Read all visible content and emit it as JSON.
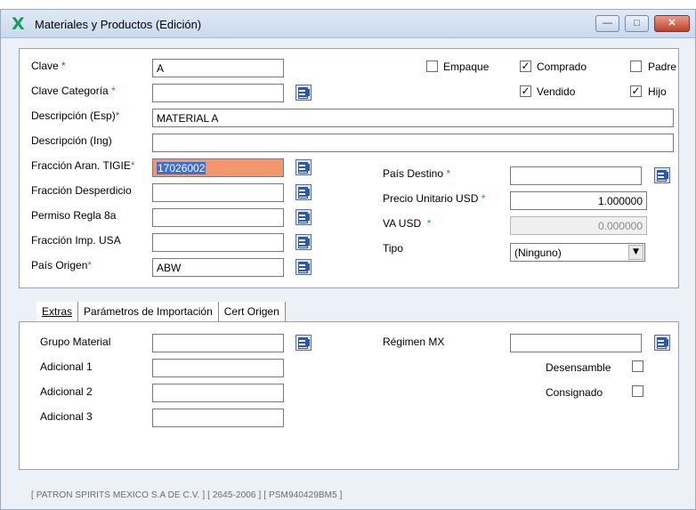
{
  "window": {
    "logo": "X",
    "title": "Materiales y Productos (Edición)",
    "minimize": "—",
    "maximize": "□",
    "close": "✕"
  },
  "form": {
    "clave": {
      "label": "Clave",
      "req": "*",
      "value": "A"
    },
    "clave_categoria": {
      "label": "Clave Categoría",
      "req": "*",
      "value": ""
    },
    "descripcion_esp": {
      "label": "Descripción (Esp)",
      "req": "*",
      "value": "MATERIAL A"
    },
    "descripcion_ing": {
      "label": "Descripción (Ing)",
      "value": ""
    },
    "fraccion_aran_tigie": {
      "label": "Fracción Aran. TIGIE",
      "req": "*",
      "value": "17026002"
    },
    "fraccion_desperdicio": {
      "label": "Fracción Desperdicio",
      "value": ""
    },
    "permiso_regla_8a": {
      "label": "Permiso Regla 8a",
      "value": ""
    },
    "fraccion_imp_usa": {
      "label": "Fracción Imp. USA",
      "value": ""
    },
    "pais_origen": {
      "label": "País Origen",
      "req": "*",
      "value": "ABW"
    },
    "pais_destino": {
      "label": "País Destino",
      "req": "*",
      "value": ""
    },
    "precio_unitario_usd": {
      "label": "Precio Unitario USD",
      "req": "*",
      "value": "1.000000"
    },
    "va_usd": {
      "label": "VA USD",
      "req": "*",
      "value": "0.000000"
    },
    "tipo": {
      "label": "Tipo",
      "value": "(Ninguno)"
    },
    "checkboxes": {
      "empaque": {
        "label": "Empaque",
        "checked": false,
        "mark": ""
      },
      "comprado": {
        "label": "Comprado",
        "checked": true,
        "mark": "✓"
      },
      "padre": {
        "label": "Padre",
        "checked": false,
        "mark": ""
      },
      "vendido": {
        "label": "Vendido",
        "checked": true,
        "mark": "✓"
      },
      "hijo": {
        "label": "Hijo",
        "checked": true,
        "mark": "✓"
      }
    }
  },
  "tabs": [
    {
      "label": "Extras",
      "active": true
    },
    {
      "label": "Parámetros de Importación",
      "active": false
    },
    {
      "label": "Cert Origen",
      "active": false
    }
  ],
  "extras": {
    "grupo_material": {
      "label": "Grupo Material",
      "value": ""
    },
    "adicional_1": {
      "label": "Adicional 1",
      "value": ""
    },
    "adicional_2": {
      "label": "Adicional 2",
      "value": ""
    },
    "adicional_3": {
      "label": "Adicional 3",
      "value": ""
    },
    "regimen_mx": {
      "label": "Régimen MX",
      "value": ""
    },
    "desensamble": {
      "label": "Desensamble",
      "checked": false,
      "mark": ""
    },
    "consignado": {
      "label": "Consignado",
      "checked": false,
      "mark": ""
    }
  },
  "status_bar": "[ PATRON SPIRITS MEXICO S.A DE C.V. ]  [ 2645-2006 ]  [ PSM940429BM5 ]",
  "colors": {
    "focused_field_bg": "#f4976c",
    "required_red": "#d8202a",
    "required_green": "#2a9d48",
    "brand_green": "#1f9a62"
  }
}
